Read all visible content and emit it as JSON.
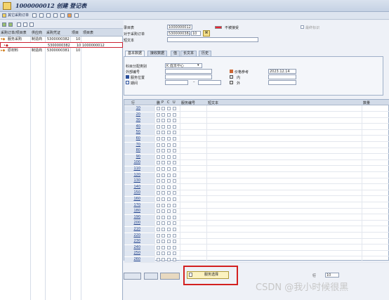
{
  "window": {
    "title": "1000000012 创建 登记表"
  },
  "toolbar": {
    "other_po_button": "其它采购订单"
  },
  "left_pane": {
    "headers": [
      "采购订单/项目表",
      "供应商",
      "采购凭证",
      "项目",
      "项目表"
    ],
    "rows": [
      {
        "name": "服务采购",
        "vendor": "制造商",
        "doc": "5300000382",
        "item": "10",
        "sheet": ""
      },
      {
        "name": "",
        "vendor": "",
        "doc": "5300000382",
        "item": "10",
        "sheet": "1000000012"
      },
      {
        "name": "原材料",
        "vendor": "制造商",
        "doc": "5300000381",
        "item": "10",
        "sheet": ""
      }
    ]
  },
  "header": {
    "sheet_label": "录目表",
    "sheet_value": "1000000012",
    "status_label": "不被接受",
    "final_entry_label": "最终标识",
    "po_label": "对于采购订单",
    "po_value": "5300000382",
    "po_item": "10",
    "short_text_label": "短文本",
    "short_text_value": ""
  },
  "tabs": [
    "基本数据",
    "接收数据",
    "值",
    "长文本",
    "历史"
  ],
  "basic_data": {
    "acct_assign_label": "科目分配类别",
    "acct_assign_value": "K 成本中心",
    "ext_number_label": "外部编号",
    "ext_number_value": "",
    "service_loc_label": "服务位置",
    "service_loc_value": "",
    "period_label": "期间",
    "period_from": "",
    "period_to": "",
    "price_ref_label": "价格参考",
    "price_ref_value": "2023.12.14",
    "inside_label": "内",
    "inside_value": "",
    "outside_label": "外",
    "outside_value": ""
  },
  "grid": {
    "headers": {
      "line": "行",
      "d": "删",
      "p": "P",
      "c": "C",
      "u": "U",
      "service_no": "服务编号",
      "short_text": "短文本",
      "quantity": "数量"
    },
    "lines": [
      "10",
      "20",
      "30",
      "40",
      "50",
      "60",
      "70",
      "80",
      "90",
      "100",
      "110",
      "120",
      "130",
      "140",
      "150",
      "160",
      "170",
      "180",
      "190",
      "200",
      "210",
      "220",
      "230",
      "240",
      "250",
      "260"
    ]
  },
  "footer": {
    "service_select_button": "服务选择",
    "line_label": "行",
    "line_value": "10"
  },
  "watermark": "CSDN @我小时候很黑",
  "colors": {
    "highlight": "#d32020"
  }
}
